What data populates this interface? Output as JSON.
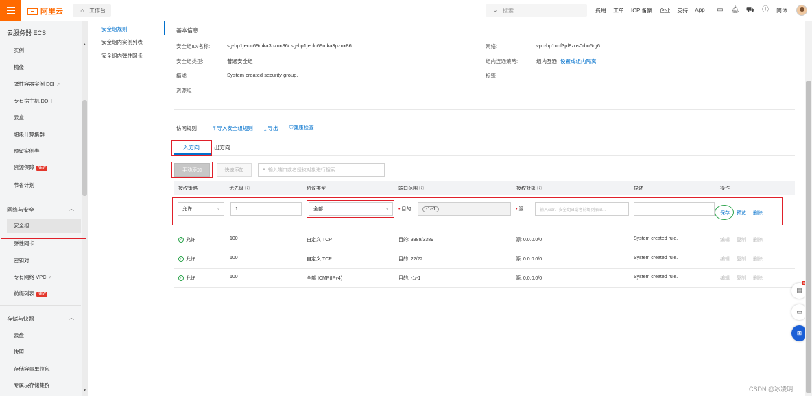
{
  "topbar": {
    "brand": "阿里云",
    "workbench": "工作台",
    "search_placeholder": "搜索...",
    "nav": [
      "费用",
      "工单",
      "ICP 备案",
      "企业",
      "支持",
      "App"
    ],
    "lang": "简体"
  },
  "sidebar": {
    "header": "云服务器 ECS",
    "items": [
      {
        "label": "实例"
      },
      {
        "label": "镜像"
      },
      {
        "label": "弹性容器实例 ECI"
      },
      {
        "label": "专有宿主机 DDH"
      },
      {
        "label": "云盒"
      },
      {
        "label": "超级计算集群"
      },
      {
        "label": "预留实例券"
      },
      {
        "label": "资源保障",
        "badge": "NEW"
      },
      {
        "label": "节省计划"
      }
    ],
    "group_network": "网络与安全",
    "network_items": [
      {
        "label": "安全组"
      },
      {
        "label": "弹性网卡"
      },
      {
        "label": "密钥对"
      },
      {
        "label": "专有网络 VPC"
      },
      {
        "label": "前缀列表",
        "badge": "NEW"
      }
    ],
    "group_storage": "存储与快照",
    "storage_items": [
      {
        "label": "云盘"
      },
      {
        "label": "快照"
      },
      {
        "label": "存储容量单位包"
      },
      {
        "label": "专属块存储集群"
      }
    ]
  },
  "subnav": {
    "items": [
      "安全组规则",
      "安全组内实例列表",
      "安全组内弹性网卡"
    ]
  },
  "basic": {
    "title": "基本信息",
    "id_label": "安全组ID/名称:",
    "id_value": "sg-bp1jeclc69mka3pznx86/ sg-bp1jeclc69mka3pznx86",
    "type_label": "安全组类型:",
    "type_value": "普通安全组",
    "desc_label": "描述:",
    "desc_value": "System created security group.",
    "rg_label": "资源组:",
    "net_label": "网络:",
    "net_value": "vpc-bp1unf3pl8zos0rbu5rg6",
    "policy_label": "组内连通策略:",
    "policy_value": "组内互通",
    "policy_link": "设置成组内隔离",
    "tag_label": "标签:"
  },
  "rules": {
    "title": "访问规则",
    "import": "导入安全组规则",
    "export": "导出",
    "health": "健康检查",
    "tab_in": "入方向",
    "tab_out": "出方向",
    "btn_manual": "手动添加",
    "btn_quick": "快速添加",
    "search_placeholder": "输入端口或者授权对象进行搜索",
    "columns": [
      "授权策略",
      "优先级",
      "协议类型",
      "端口范围",
      "授权对象",
      "描述",
      "操作"
    ],
    "edit_row": {
      "policy": "允许",
      "priority": "1",
      "protocol": "全部",
      "port_label": "目的:",
      "port_value": "-1/-1",
      "src_label": "源:",
      "src_placeholder": "输入cidr、安全组id或者前缀列表id...",
      "save": "保存",
      "preview": "预览",
      "delete": "删除"
    },
    "rows": [
      {
        "policy": "允许",
        "priority": "100",
        "protocol": "自定义 TCP",
        "port": "目的: 3389/3389",
        "source": "源: 0.0.0.0/0",
        "desc": "System created rule.",
        "ops": [
          "编辑",
          "复制",
          "删除"
        ]
      },
      {
        "policy": "允许",
        "priority": "100",
        "protocol": "自定义 TCP",
        "port": "目的: 22/22",
        "source": "源: 0.0.0.0/0",
        "desc": "System created rule.",
        "ops": [
          "编辑",
          "复制",
          "删除"
        ]
      },
      {
        "policy": "允许",
        "priority": "100",
        "protocol": "全部 ICMP(IPv4)",
        "port": "目的: -1/-1",
        "source": "源: 0.0.0.0/0",
        "desc": "System created rule.",
        "ops": [
          "编辑",
          "复制",
          "删除"
        ]
      }
    ]
  },
  "float_badge": "NEW",
  "watermark": "CSDN @冰凌明"
}
